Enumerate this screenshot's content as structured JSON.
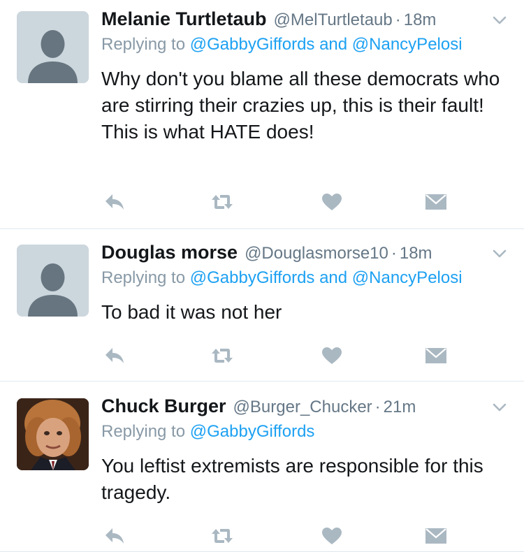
{
  "tweets": [
    {
      "name": "Melanie  Turtletaub",
      "handle": "@MelTurtletaub",
      "separator": "·",
      "time": "18m",
      "reply_prefix": "Replying to",
      "reply_to": "@GabbyGiffords and @NancyPelosi",
      "text": "Why don't you blame all these democrats who are stirring their crazies up, this is their fault!  This is what HATE does!",
      "avatar": "default-avatar-icon"
    },
    {
      "name": "Douglas morse",
      "handle": "@Douglasmorse10",
      "separator": "·",
      "time": "18m",
      "reply_prefix": "Replying to",
      "reply_to": "@GabbyGiffords and @NancyPelosi",
      "text": "To bad it was not her",
      "avatar": "default-avatar-icon"
    },
    {
      "name": "Chuck Burger",
      "handle": "@Burger_Chucker",
      "separator": "·",
      "time": "21m",
      "reply_prefix": "Replying to",
      "reply_to": "@GabbyGiffords",
      "text": "You leftist extremists are responsible for this tragedy.",
      "avatar": "photo-avatar"
    }
  ],
  "icons": {
    "reply": "reply-icon",
    "retweet": "retweet-icon",
    "like": "heart-icon",
    "dm": "envelope-icon",
    "more": "chevron-down-icon"
  },
  "colors": {
    "name": "#14171a",
    "meta": "#657786",
    "link": "#1da1f2",
    "icon": "#aab8c2",
    "divider": "#e1e8ed"
  }
}
